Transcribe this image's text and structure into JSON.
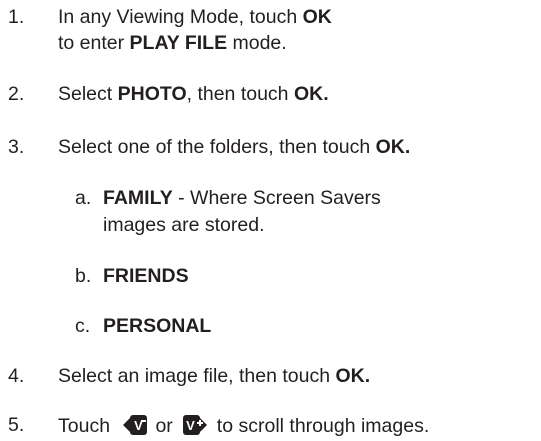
{
  "steps": [
    {
      "number": "1.",
      "line1": {
        "pre": "In any Viewing Mode, touch ",
        "b1": "OK"
      },
      "line2": {
        "pre": "to enter ",
        "b1": "PLAY FILE",
        "post": " mode."
      }
    },
    {
      "number": "2.",
      "line1": {
        "pre": "Select ",
        "b1": "PHOTO",
        "mid": ", then touch ",
        "b2": "OK."
      }
    },
    {
      "number": "3.",
      "line1": {
        "pre": "Select one of the folders, then touch ",
        "b1": "OK."
      },
      "subitems": [
        {
          "letter": "a.",
          "b1": "FAMILY",
          "post": " - Where Screen Savers",
          "line2": "images are stored."
        },
        {
          "letter": "b.",
          "b1": "FRIENDS"
        },
        {
          "letter": "c.",
          "b1": "PERSONAL"
        }
      ]
    },
    {
      "number": "4.",
      "line1": {
        "pre": "Select an image file, then touch ",
        "b1": "OK."
      }
    },
    {
      "number": "5.",
      "line1": {
        "pre": "Touch ",
        "or": "or",
        "post": "to scroll through images."
      },
      "icons": [
        "volume-down-back-icon",
        "volume-up-forward-icon"
      ]
    }
  ],
  "colors": {
    "text": "#231f20",
    "icon_fill": "#231f20"
  }
}
